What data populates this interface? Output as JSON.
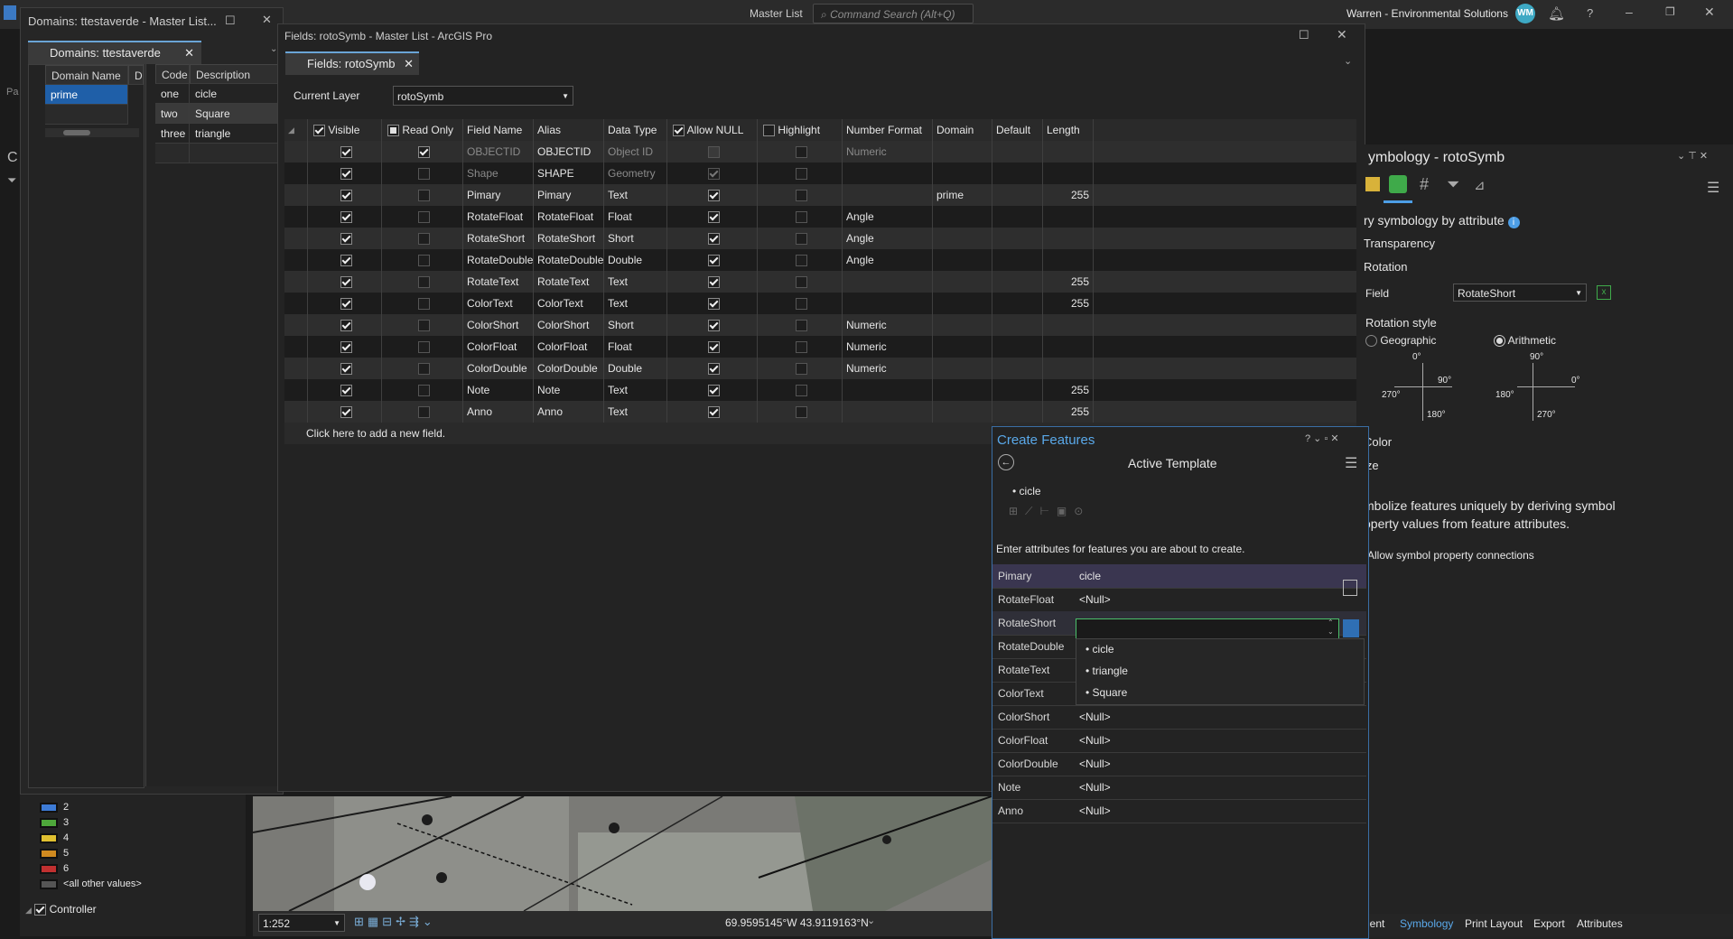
{
  "topbar": {
    "project": "Master List",
    "command_search_placeholder": "Command Search (Alt+Q)",
    "org": "Warren - Environmental Solutions",
    "avatar": "WM"
  },
  "domains_window": {
    "title": "Domains: ttestaverde - Master List...",
    "tab": "Domains: ttestaverde",
    "columns": [
      "Domain Name",
      "De"
    ],
    "domains": [
      "prime"
    ],
    "code_columns": [
      "Code",
      "Description"
    ],
    "codes": [
      {
        "code": "one",
        "desc": "cicle"
      },
      {
        "code": "two",
        "desc": "Square"
      },
      {
        "code": "three",
        "desc": "triangle"
      }
    ]
  },
  "fields_window": {
    "title": "Fields: rotoSymb - Master List - ArcGIS Pro",
    "tab": "Fields: rotoSymb",
    "current_layer_label": "Current Layer",
    "current_layer": "rotoSymb",
    "columns": [
      "Visible",
      "Read Only",
      "Field Name",
      "Alias",
      "Data Type",
      "Allow NULL",
      "Highlight",
      "Number Format",
      "Domain",
      "Default",
      "Length"
    ],
    "rows": [
      {
        "visible": true,
        "readonly": true,
        "name": "OBJECTID",
        "alias": "OBJECTID",
        "type": "Object ID",
        "allow_null": false,
        "highlight": false,
        "format": "Numeric",
        "domain": "",
        "default": "",
        "length": "",
        "dim": true
      },
      {
        "visible": true,
        "readonly": false,
        "name": "Shape",
        "alias": "SHAPE",
        "type": "Geometry",
        "allow_null": true,
        "highlight": false,
        "format": "",
        "domain": "",
        "default": "",
        "length": "",
        "dim": true
      },
      {
        "visible": true,
        "readonly": false,
        "name": "Pimary",
        "alias": "Pimary",
        "type": "Text",
        "allow_null": true,
        "highlight": false,
        "format": "",
        "domain": "prime",
        "default": "",
        "length": "255"
      },
      {
        "visible": true,
        "readonly": false,
        "name": "RotateFloat",
        "alias": "RotateFloat",
        "type": "Float",
        "allow_null": true,
        "highlight": false,
        "format": "Angle",
        "domain": "",
        "default": "",
        "length": ""
      },
      {
        "visible": true,
        "readonly": false,
        "name": "RotateShort",
        "alias": "RotateShort",
        "type": "Short",
        "allow_null": true,
        "highlight": false,
        "format": "Angle",
        "domain": "",
        "default": "",
        "length": ""
      },
      {
        "visible": true,
        "readonly": false,
        "name": "RotateDouble",
        "alias": "RotateDouble",
        "type": "Double",
        "allow_null": true,
        "highlight": false,
        "format": "Angle",
        "domain": "",
        "default": "",
        "length": ""
      },
      {
        "visible": true,
        "readonly": false,
        "name": "RotateText",
        "alias": "RotateText",
        "type": "Text",
        "allow_null": true,
        "highlight": false,
        "format": "",
        "domain": "",
        "default": "",
        "length": "255"
      },
      {
        "visible": true,
        "readonly": false,
        "name": "ColorText",
        "alias": "ColorText",
        "type": "Text",
        "allow_null": true,
        "highlight": false,
        "format": "",
        "domain": "",
        "default": "",
        "length": "255"
      },
      {
        "visible": true,
        "readonly": false,
        "name": "ColorShort",
        "alias": "ColorShort",
        "type": "Short",
        "allow_null": true,
        "highlight": false,
        "format": "Numeric",
        "domain": "",
        "default": "",
        "length": ""
      },
      {
        "visible": true,
        "readonly": false,
        "name": "ColorFloat",
        "alias": "ColorFloat",
        "type": "Float",
        "allow_null": true,
        "highlight": false,
        "format": "Numeric",
        "domain": "",
        "default": "",
        "length": ""
      },
      {
        "visible": true,
        "readonly": false,
        "name": "ColorDouble",
        "alias": "ColorDouble",
        "type": "Double",
        "allow_null": true,
        "highlight": false,
        "format": "Numeric",
        "domain": "",
        "default": "",
        "length": ""
      },
      {
        "visible": true,
        "readonly": false,
        "name": "Note",
        "alias": "Note",
        "type": "Text",
        "allow_null": true,
        "highlight": false,
        "format": "",
        "domain": "",
        "default": "",
        "length": "255"
      },
      {
        "visible": true,
        "readonly": false,
        "name": "Anno",
        "alias": "Anno",
        "type": "Text",
        "allow_null": true,
        "highlight": false,
        "format": "",
        "domain": "",
        "default": "",
        "length": "255"
      }
    ],
    "add_field": "Click here to add a new field."
  },
  "symbology": {
    "title": "ymbology - rotoSymb",
    "section": "ry symbology by attribute",
    "transparency": "Transparency",
    "rotation": "Rotation",
    "field_label": "Field",
    "field_value": "RotateShort",
    "rotation_style": "Rotation style",
    "geographic": "Geographic",
    "arithmetic": "Arithmetic",
    "geo_labels": {
      "top": "0°",
      "right": "90°",
      "bottom": "180°",
      "left": "270°"
    },
    "ari_labels": {
      "top": "90°",
      "right": "0°",
      "bottom": "270°",
      "left": "180°"
    },
    "color": "Color",
    "size": "ize",
    "desc": "mbolize features uniquely by deriving symbol\noperty values from feature attributes.",
    "allow_connections": "Allow symbol property connections",
    "bottom_tabs": [
      "nent",
      "Symbology",
      "Print Layout",
      "Export",
      "Attributes"
    ]
  },
  "create_features": {
    "title": "Create Features",
    "subtitle": "Active Template",
    "template": "cicle",
    "instructions": "Enter attributes for features you are about to create.",
    "attributes": [
      {
        "name": "Pimary",
        "value": "cicle"
      },
      {
        "name": "RotateFloat",
        "value": "<Null>"
      },
      {
        "name": "RotateShort",
        "value": ""
      },
      {
        "name": "RotateDouble",
        "value": ""
      },
      {
        "name": "RotateText",
        "value": ""
      },
      {
        "name": "ColorText",
        "value": ""
      },
      {
        "name": "ColorShort",
        "value": "<Null>"
      },
      {
        "name": "ColorFloat",
        "value": "<Null>"
      },
      {
        "name": "ColorDouble",
        "value": "<Null>"
      },
      {
        "name": "Note",
        "value": "<Null>"
      },
      {
        "name": "Anno",
        "value": "<Null>"
      }
    ],
    "dropdown": [
      "cicle",
      "triangle",
      "Square"
    ]
  },
  "legend": {
    "items": [
      "2",
      "3",
      "4",
      "5",
      "6",
      "<all other values>"
    ],
    "colors": [
      "#3d7bd6",
      "#4ea83b",
      "#e0c030",
      "#d08a20",
      "#c03030",
      "#555555"
    ],
    "layer": "Controller"
  },
  "map_status": {
    "scale": "1:252",
    "coords": "69.9595145°W 43.9119163°N"
  },
  "left_stubs": [
    "Pa",
    "C"
  ]
}
